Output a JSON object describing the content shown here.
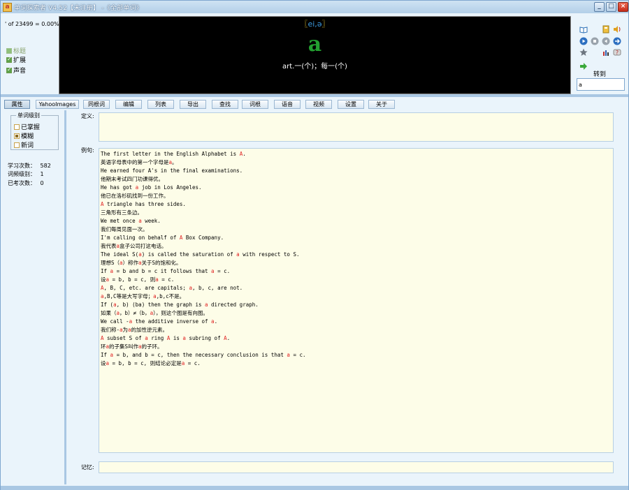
{
  "window": {
    "title": "单词探索者 V4.52【未注册】 -《全部单词》",
    "buttons": {
      "minimize": "_",
      "maximize": "□",
      "close": "×"
    }
  },
  "status": {
    "progress": "' of 23499 = 0.00%"
  },
  "options": [
    {
      "label": "标题",
      "checked": false,
      "disabled": true
    },
    {
      "label": "扩展",
      "checked": true
    },
    {
      "label": "声音",
      "checked": true
    }
  ],
  "display": {
    "phonetic_open": "〖",
    "phonetic": "ei,ə",
    "phonetic_close": "〗",
    "word": "a",
    "meaning": "art.一(个)；每一(个)"
  },
  "goto": {
    "label": "转到",
    "value": "a"
  },
  "tabs": [
    "属性",
    "YahooImages",
    "同根词",
    "编辑",
    "列表",
    "导出",
    "查找",
    "词根",
    "语音",
    "视频",
    "设置",
    "关于"
  ],
  "level": {
    "title": "单词级别",
    "options": [
      {
        "label": "已掌握",
        "checked": false
      },
      {
        "label": "模糊",
        "checked": true
      },
      {
        "label": "新词",
        "checked": false
      }
    ]
  },
  "stats": [
    {
      "label": "学习次数：",
      "value": "582"
    },
    {
      "label": "词频级别：",
      "value": "1"
    },
    {
      "label": "已考次数：",
      "value": "0"
    }
  ],
  "fields": {
    "definition_label": "定义:",
    "definition": "",
    "examples_label": "例句:",
    "memory_label": "记忆:",
    "memory": ""
  },
  "examples": [
    "The first letter in the English Alphabet is A.",
    "英语字母表中的第一个字母是a。",
    "He earned four A's in the final examinations.",
    "他期末考试四门功课得优。",
    "He has got a job in Los Angeles.",
    "他已在洛杉矶找到一份工作。",
    "A triangle has three sides.",
    "三角形有三条边。",
    "We met once a week.",
    "我们每周见面一次。",
    "I'm calling on behalf of A Box Company.",
    "我代表a盒子公司打这电话。",
    "The ideal S(a) is called the saturation of a with respect to S.",
    "理想S（a）称作a关于S的饱和化。",
    "If a = b and b = c it follows that a = c.",
    "设a = b, b = c, 则a = c.",
    "A, B, C, etc. are capitals; a, b, c, are not.",
    "a,B,C等是大写字母；a,b,c不是。",
    "If (a, b) (ba) then the graph is a directed graph.",
    "如果（a，b）≠（b，a），则这个图是有向图。",
    "We call -a the additive inverse of a.",
    "我们称-a为a的加性逆元素。",
    "A subset S of a ring A is a subring of A.",
    "环a的子集S叫作a的子环。",
    "If a = b, and b = c, then the necessary conclusion is that a = c.",
    "设a = b, b = c, 则结论必定是a = c."
  ],
  "colors": {
    "highlight": "#e02020",
    "headword": "#23a030",
    "phonetic": "#3c9be0",
    "field_bg": "#fdfde8"
  },
  "icons": [
    "open-book-icon",
    "notebook-icon",
    "speaker-icon",
    "play-icon",
    "stop-icon",
    "replay-icon",
    "next-icon",
    "star-icon",
    "bar-chart-icon",
    "help-icon",
    "arrow-right-icon"
  ]
}
